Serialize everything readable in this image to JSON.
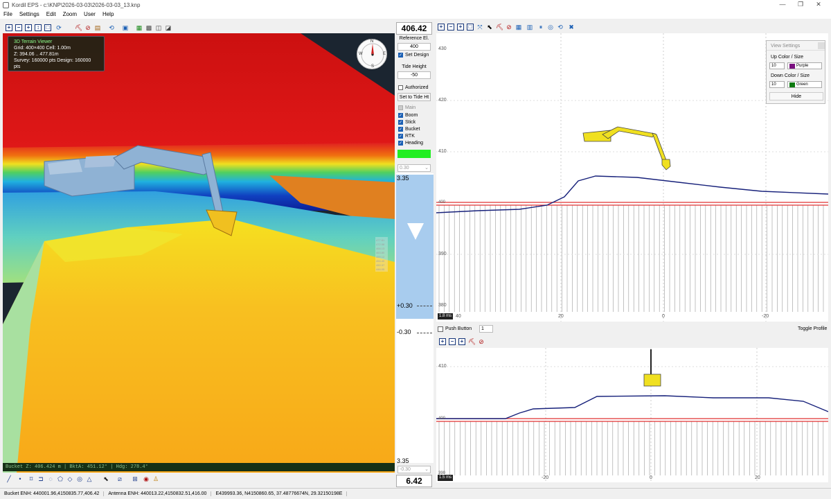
{
  "window": {
    "title": "Kordil EPS - c:\\KNP\\2026-03-03\\2026-03-03_13.knp",
    "minimize": "—",
    "maximize": "❐",
    "close": "✕"
  },
  "menu": [
    "File",
    "Settings",
    "Edit",
    "Zoom",
    "User",
    "Help"
  ],
  "viewer": {
    "info_title": "3D Terrain Viewer",
    "grid": "Grid: 400×400  Cell: 1.00m",
    "z": "Z: 394.06 .. 477.81m",
    "survey": "Survey: 160000 pts  Design: 160000 pts",
    "compass": {
      "n": "N",
      "s": "S",
      "e": "E",
      "w": "W"
    },
    "legend_values": [
      "477.81",
      "472.58",
      "468.13",
      "463.80",
      "459.12",
      "454.40",
      "450.37",
      "446.05"
    ],
    "status": "Bucket Z: 406.424 m | BktA: 451.12° | Hdg: 278.4°"
  },
  "panel": {
    "elevation": "406.42",
    "reference_label": "Reference El.",
    "reference_value": "400",
    "set_design": "Set Design",
    "tide_label": "Tide Height",
    "tide_value": "-50",
    "authorized": "Authorized",
    "set_tide_button": "Set to Tide Ht",
    "checks": [
      {
        "label": "Main",
        "state": "disabled"
      },
      {
        "label": "Boom",
        "state": "on"
      },
      {
        "label": "Stick",
        "state": "on"
      },
      {
        "label": "Bucket",
        "state": "on"
      },
      {
        "label": "RTK",
        "state": "on"
      },
      {
        "label": "Heading",
        "state": "on"
      }
    ],
    "status_color": "#22ee22",
    "tolerance_select": "0.30",
    "gauge_top": "3.35",
    "gauge_plus": "+0.30",
    "gauge_minus": "-0.30",
    "gauge_bottom": "3.35",
    "bottom_select": "-0.30",
    "bottom_value": "6.42"
  },
  "profile_top": {
    "y_ticks": [
      "430",
      "420",
      "410",
      "390",
      "380"
    ],
    "y_value_line": "400",
    "x_ticks": [
      "40",
      "20",
      "0",
      "-20"
    ],
    "time_badge": "1.8 ms",
    "view_settings": {
      "title": "View Settings",
      "up_label": "Up Color / Size",
      "up_size": "10",
      "up_color": "Purple",
      "up_swatch": "#7a1080",
      "down_label": "Down Color / Size",
      "down_size": "10",
      "down_color": "Green",
      "down_swatch": "#0d7a10",
      "hide": "Hide"
    },
    "profile_color": "#16207a",
    "design_color": "#e03030"
  },
  "profile_controls": {
    "push_button": "Push Button",
    "spin_value": "1",
    "toggle": "Toggle Profile"
  },
  "profile_bot": {
    "y_ticks": [
      "410",
      "400",
      "390"
    ],
    "x_ticks": [
      "-20",
      "0",
      "20"
    ],
    "time_badge": "1.5 ms"
  },
  "footer": {
    "bucket": "Bucket ENH: 440001.96,4150835.77,406.42",
    "antenna": "Antenna ENH: 440013.22,4150832.51,416.00",
    "geo": "E439993.36, N4150860.65, 37.48776674N, 29.32150198E"
  }
}
